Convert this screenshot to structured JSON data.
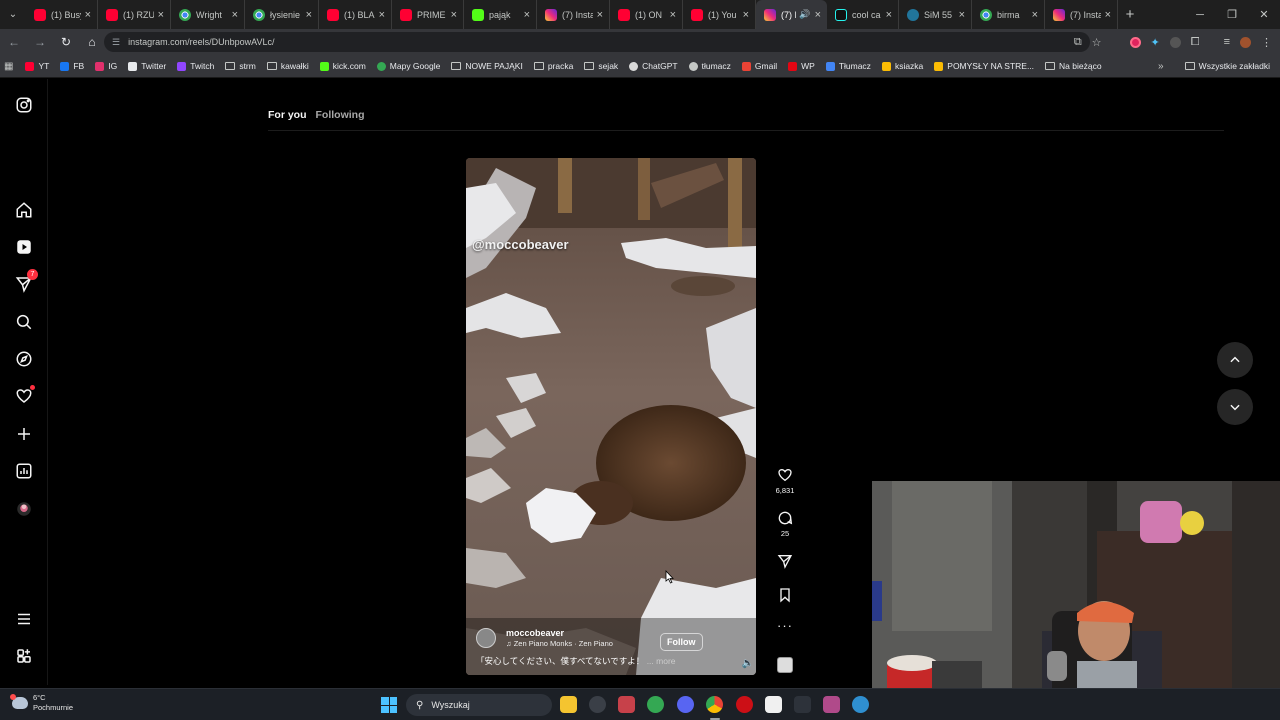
{
  "browser": {
    "tabs": [
      {
        "title": "(1) Busy",
        "favicon": "youtube-icon",
        "active": false
      },
      {
        "title": "(1) RZU",
        "favicon": "youtube-icon",
        "active": false
      },
      {
        "title": "Wright",
        "favicon": "chrome-icon",
        "active": false
      },
      {
        "title": "łysienie",
        "favicon": "chrome-icon",
        "active": false
      },
      {
        "title": "(1) BLA",
        "favicon": "youtube-icon",
        "active": false
      },
      {
        "title": "PRIME",
        "favicon": "youtube-icon",
        "active": false
      },
      {
        "title": "pająk",
        "favicon": "kick-icon",
        "active": false
      },
      {
        "title": "(7) Insta",
        "favicon": "instagram-icon",
        "active": false
      },
      {
        "title": "(1) ON",
        "favicon": "youtube-icon",
        "active": false
      },
      {
        "title": "(1) You",
        "favicon": "youtube-icon",
        "active": false
      },
      {
        "title": "(7) I",
        "favicon": "instagram-icon",
        "active": true,
        "audio": "🔊"
      },
      {
        "title": "cool ca",
        "favicon": "tiktok-icon",
        "active": false
      },
      {
        "title": "SiM 55",
        "favicon": "wordpress-icon",
        "active": false
      },
      {
        "title": "birma",
        "favicon": "chrome-icon",
        "active": false
      },
      {
        "title": "(7) Insta",
        "favicon": "instagram-icon",
        "active": false
      }
    ],
    "url": "instagram.com/reels/DUnbpowAVLc/",
    "bookmarks": [
      {
        "label": "YT",
        "icon": "youtube-icon",
        "color": "#ff0033"
      },
      {
        "label": "FB",
        "icon": "facebook-icon",
        "color": "#1877f2"
      },
      {
        "label": "IG",
        "icon": "instagram-icon",
        "color": "#e1306c"
      },
      {
        "label": "Twitter",
        "icon": "x-icon",
        "color": "#e8eaed"
      },
      {
        "label": "Twitch",
        "icon": "twitch-icon",
        "color": "#9146ff"
      },
      {
        "label": "strm",
        "icon": "folder-icon"
      },
      {
        "label": "kawałki",
        "icon": "folder-icon"
      },
      {
        "label": "kick.com",
        "icon": "kick-icon",
        "color": "#53fc18"
      },
      {
        "label": "Mapy Google",
        "icon": "maps-icon",
        "color": "#34a853"
      },
      {
        "label": "NOWE PAJĄKI",
        "icon": "folder-icon"
      },
      {
        "label": "pracka",
        "icon": "folder-icon"
      },
      {
        "label": "sejak",
        "icon": "folder-icon"
      },
      {
        "label": "ChatGPT",
        "icon": "chatgpt-icon",
        "color": "#d9d9d9"
      },
      {
        "label": "tłumacz",
        "icon": "globe-icon",
        "color": "#c4c7c5"
      },
      {
        "label": "Gmail",
        "icon": "gmail-icon",
        "color": "#ea4335"
      },
      {
        "label": "WP",
        "icon": "wp-icon",
        "color": "#e30613"
      },
      {
        "label": "Tłumacz",
        "icon": "translate-icon",
        "color": "#4285f4"
      },
      {
        "label": "ksiazka",
        "icon": "grid-icon",
        "color": "#fbbc04"
      },
      {
        "label": "POMYSŁY NA STRE...",
        "icon": "grid-icon",
        "color": "#fbbc04"
      },
      {
        "label": "Na bieżąco",
        "icon": "folder-icon"
      }
    ],
    "all_bookmarks": "Wszystkie zakładki"
  },
  "instagram": {
    "feed_tabs": [
      {
        "label": "For you",
        "active": true
      },
      {
        "label": "Following",
        "active": false
      }
    ],
    "notifications_count": "7",
    "reel": {
      "watermark": "@moccobeaver",
      "username": "moccobeaver",
      "audio": "Zen Piano Monks · Zen Piano",
      "follow_label": "Follow",
      "caption": "「安心してください、僕すべてないですよ！",
      "more_label": "... more"
    },
    "actions": {
      "likes": "6,831",
      "comments": "25"
    }
  },
  "taskbar": {
    "temperature": "6°C",
    "weather": "Pochmurnie",
    "search_placeholder": "Wyszukaj"
  }
}
